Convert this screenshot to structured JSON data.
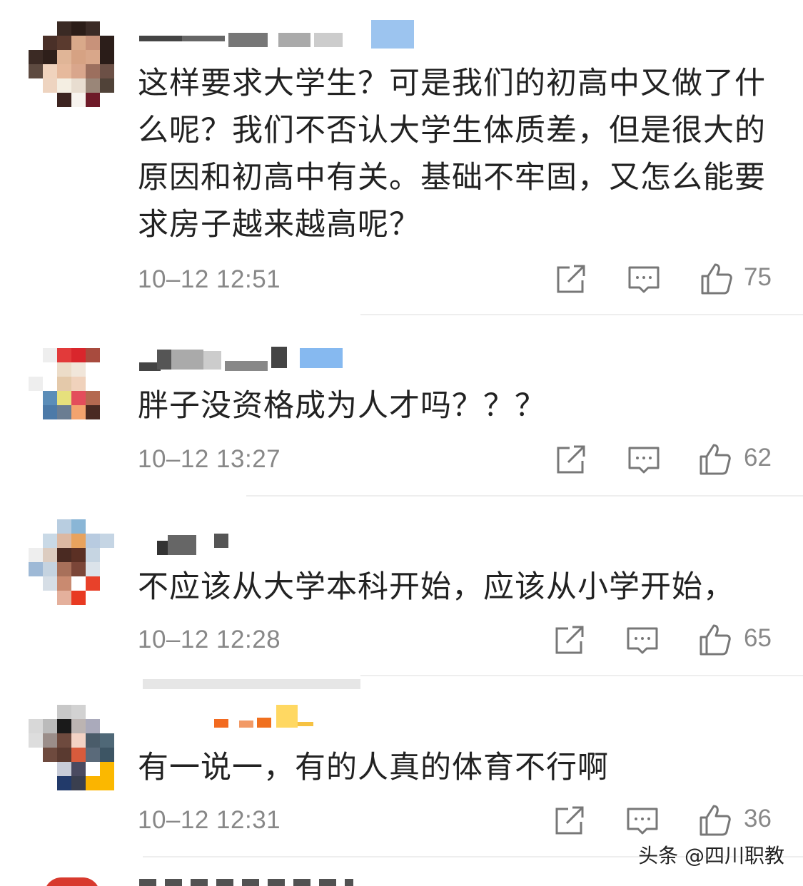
{
  "comments": [
    {
      "body": "这样要求大学生？可是我们的初高中又做了什么呢？我们不否认大学生体质差，但是很大的原因和初高中有关。基础不牢固，又怎么能要求房子越来越高呢？",
      "time": "10–12 12:51",
      "likes": "75"
    },
    {
      "body": "胖子没资格成为人才吗？？？",
      "time": "10–12 13:27",
      "likes": "62"
    },
    {
      "body": "不应该从大学本科开始，应该从小学开始，",
      "time": "10–12 12:28",
      "likes": "65"
    },
    {
      "body": "有一说一，有的人真的体育不行啊",
      "time": "10–12 12:31",
      "likes": "36"
    }
  ],
  "icons": {
    "share": "share-icon",
    "reply": "reply-icon",
    "like": "thumbs-up-icon"
  },
  "watermark": "头条 @四川职教",
  "colors": {
    "text": "#222222",
    "meta": "#888888",
    "divider": "#eeeeee"
  }
}
